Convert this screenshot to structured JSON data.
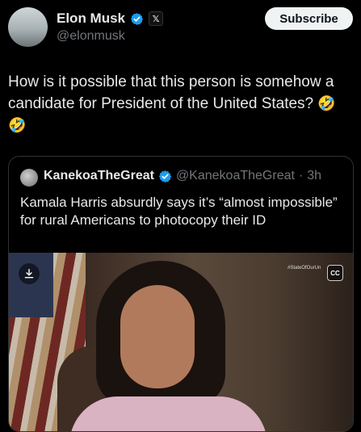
{
  "post": {
    "author_name": "Elon Musk",
    "handle": "@elonmusk",
    "subscribe_label": "Subscribe",
    "text": "How is it possible that this person is somehow a candidate for President of the United States?",
    "emojis": [
      "🤣",
      "🤣"
    ]
  },
  "quote": {
    "author_name": "KanekoaTheGreat",
    "handle": "@KanekoaTheGreat",
    "separator": "·",
    "time": "3h",
    "text": "Kamala Harris absurdly says it’s “almost impossible” for rural Americans to photocopy their ID",
    "media": {
      "watermark": "#StateOfOurUn",
      "cc_label": "CC"
    }
  },
  "colors": {
    "verified": "#1d9bf0",
    "background": "#000000",
    "muted_text": "#71767b"
  },
  "icons": {
    "verified": "verified-badge-icon",
    "x_badge": "x-logo-icon",
    "download": "download-icon",
    "closed_captions": "closed-captions-icon"
  }
}
